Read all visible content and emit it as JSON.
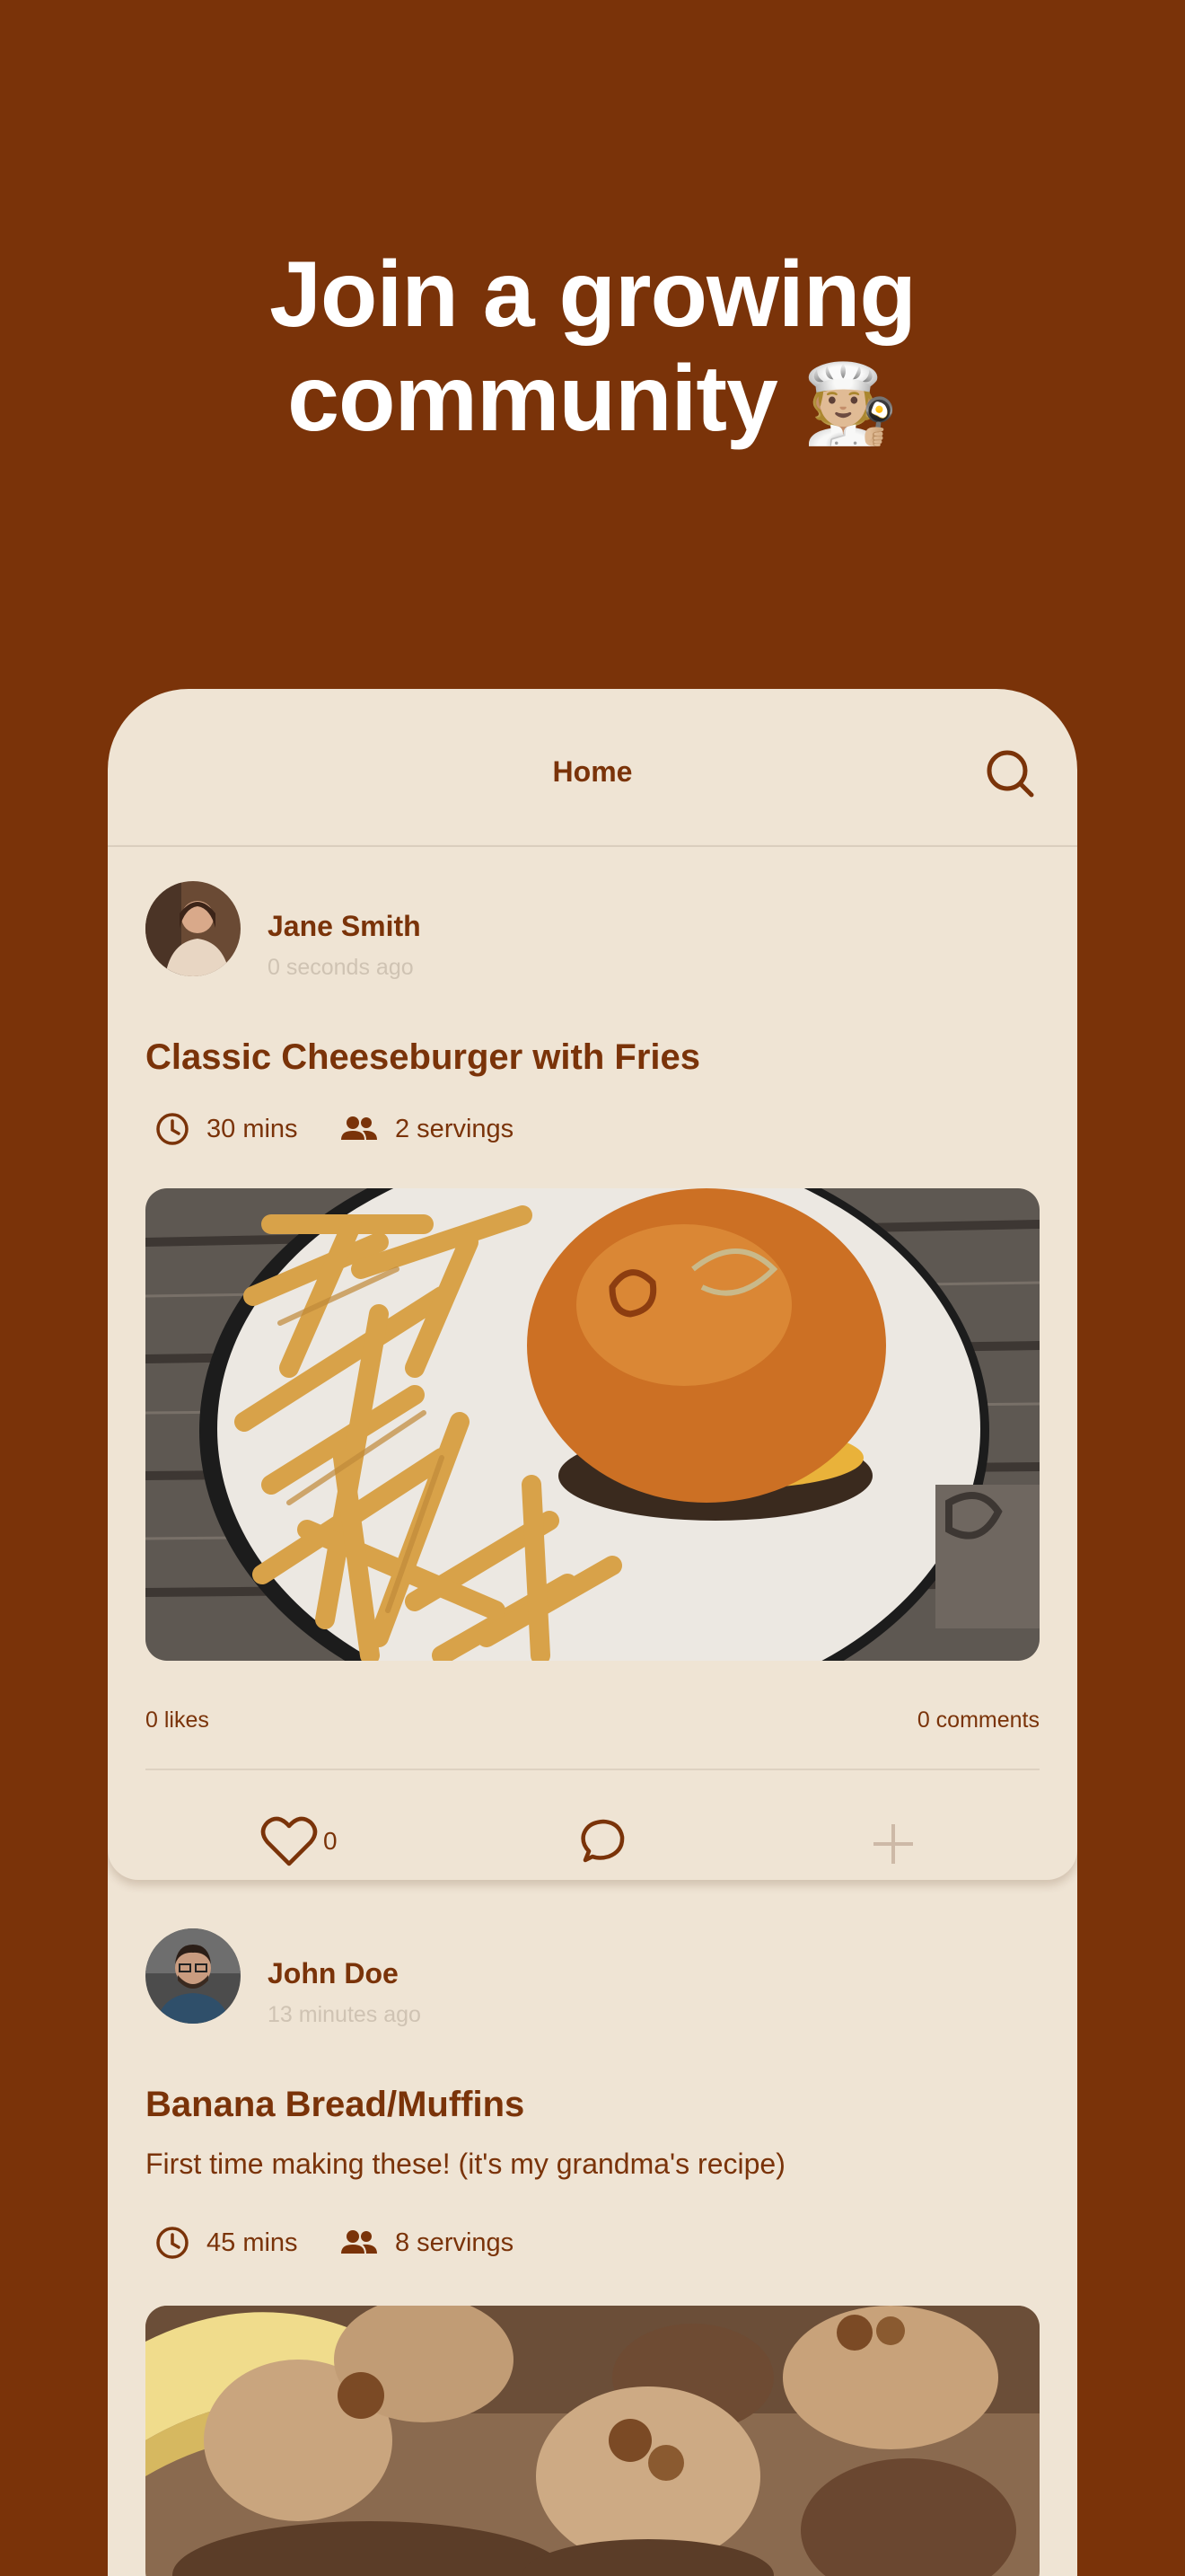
{
  "hero": {
    "line1": "Join a growing",
    "line2": "community",
    "emoji": "🧑🏼‍🍳"
  },
  "app": {
    "title": "Home",
    "search_icon": "search-icon"
  },
  "posts": [
    {
      "user": "Jane Smith",
      "time": "0 seconds ago",
      "title": "Classic Cheeseburger with Fries",
      "duration": "30 mins",
      "servings": "2 servings",
      "likes": "0 likes",
      "comments": "0 comments",
      "like_count": "0"
    },
    {
      "user": "John Doe",
      "time": "13 minutes ago",
      "title": "Banana Bread/Muffins",
      "description": "First time making these! (it's my grandma's recipe)",
      "duration": "45 mins",
      "servings": "8 servings"
    }
  ],
  "colors": {
    "brand": "#7a3309",
    "surface": "#efe4d4",
    "muted": "#cfc3b3"
  }
}
